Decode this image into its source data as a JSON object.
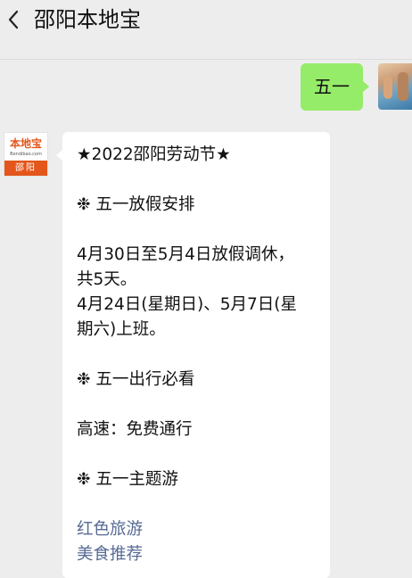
{
  "header": {
    "title": "邵阳本地宝",
    "back_glyph": "‹"
  },
  "outgoing": {
    "text": "五一"
  },
  "account_avatar": {
    "logo_text": "本地宝",
    "logo_url": "Bendibao.com",
    "band_text": "邵阳"
  },
  "incoming": {
    "line_title": "★2022邵阳劳动节★",
    "line_h1": "❉ 五一放假安排",
    "line_1a": "4月30日至5月4日放假调休，",
    "line_1b": "共5天。",
    "line_2a": "4月24日(星期日)、5月7日(星",
    "line_2b": "期六)上班。",
    "line_h2": "❉ 五一出行必看",
    "line_highway": "高速：免费通行",
    "line_h3": "❉ 五一主题游",
    "link_red": "红色旅游",
    "link_food": "美食推荐"
  },
  "colors": {
    "page_bg": "#ededed",
    "outgoing_bubble": "#95ec69",
    "incoming_bubble": "#ffffff",
    "link": "#576b95",
    "brand_orange": "#e4561b"
  }
}
